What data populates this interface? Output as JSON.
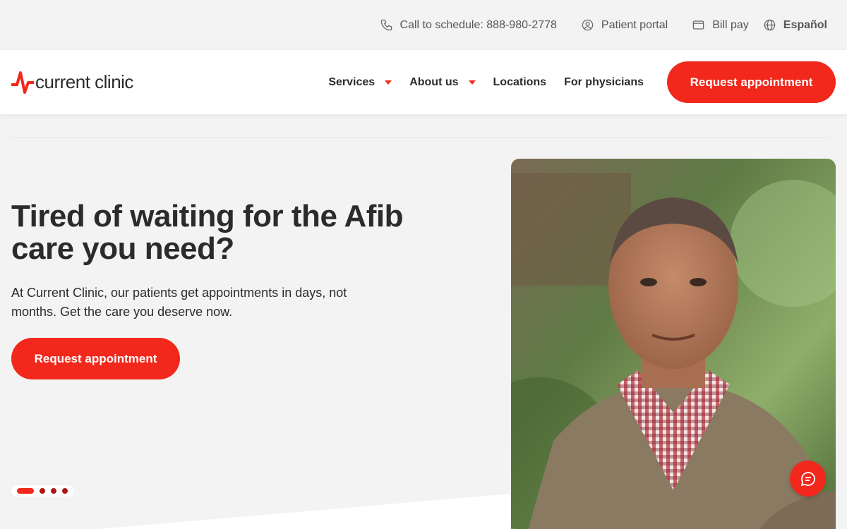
{
  "utility": {
    "phone_label": "Call to schedule: 888-980-2778",
    "portal_label": "Patient portal",
    "billpay_label": "Bill pay",
    "language_label": "Español"
  },
  "nav": {
    "logo_text": "current clinic",
    "items": [
      {
        "label": "Services",
        "has_dropdown": true
      },
      {
        "label": "About us",
        "has_dropdown": true
      },
      {
        "label": "Locations",
        "has_dropdown": false
      },
      {
        "label": "For physicians",
        "has_dropdown": false
      }
    ],
    "cta_label": "Request appointment"
  },
  "hero": {
    "title": "Tired of waiting for the Afib care you need?",
    "subtitle": "At Current Clinic, our patients get appointments in days, not months. Get the care you deserve now.",
    "cta_label": "Request appointment",
    "carousel": {
      "slides": 4,
      "active_index": 0
    }
  },
  "icons": {
    "phone": "phone-icon",
    "portal": "user-circle-icon",
    "billpay": "credit-card-icon",
    "language": "globe-icon",
    "chat": "chat-bubble-icon"
  },
  "colors": {
    "brand_red": "#f2281c",
    "dark_red": "#b01414",
    "text": "#2b2b2b",
    "background": "#f3f3f3"
  }
}
